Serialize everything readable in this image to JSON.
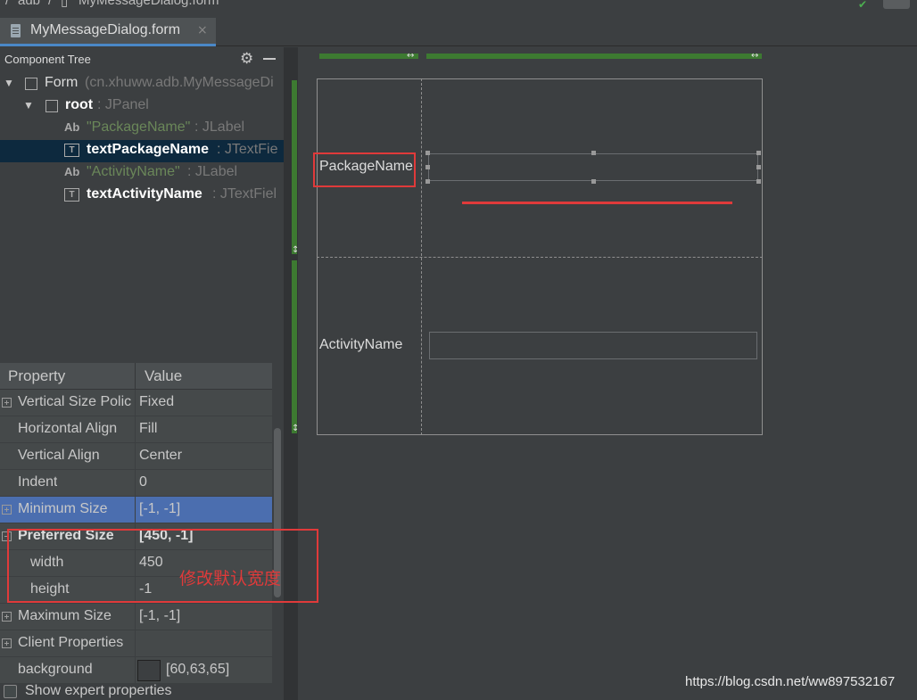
{
  "breadcrumb": {
    "project": "adb",
    "file": "MyMessageDialog.form"
  },
  "tab": {
    "label": "MyMessageDialog.form",
    "close": "×"
  },
  "component_tree": {
    "title": "Component Tree",
    "rows": [
      {
        "name": "Form",
        "detail": "(cn.xhuww.adb.MyMessageDi"
      },
      {
        "name": "root",
        "detail": " : JPanel"
      },
      {
        "name": "\"PackageName\"",
        "detail": " : JLabel",
        "icon": "Ab"
      },
      {
        "name": "textPackageName",
        "detail": " : JTextFie",
        "icon": "T"
      },
      {
        "name": "\"ActivityName\"",
        "detail": " : JLabel",
        "icon": "Ab"
      },
      {
        "name": "textActivityName",
        "detail": " : JTextFiel",
        "icon": "T"
      }
    ]
  },
  "properties": {
    "header": {
      "property": "Property",
      "value": "Value"
    },
    "rows": [
      {
        "name": "Vertical Size Polic",
        "value": "Fixed"
      },
      {
        "name": "Horizontal Align",
        "value": "Fill"
      },
      {
        "name": "Vertical Align",
        "value": "Center"
      },
      {
        "name": "Indent",
        "value": "0"
      },
      {
        "name": "Minimum Size",
        "value": "[-1, -1]"
      },
      {
        "name": "Preferred Size",
        "value": "[450, -1]"
      },
      {
        "name": "width",
        "value": "450"
      },
      {
        "name": "height",
        "value": "-1"
      },
      {
        "name": "Maximum Size",
        "value": "[-1, -1]"
      },
      {
        "name": "Client Properties",
        "value": ""
      },
      {
        "name": "background",
        "value": "[60,63,65]"
      }
    ],
    "show_expert": "Show expert properties"
  },
  "form_preview": {
    "package_label": "PackageName",
    "activity_label": "ActivityName"
  },
  "annotation": "修改默认宽度",
  "watermark": "https://blog.csdn.net/ww897532167",
  "colors": {
    "selection": "#4b6eaf",
    "tree_selection": "#0d293e",
    "annotation_red": "#e03a3a",
    "label_green": "#6a8759",
    "gutter_green": "#3d7a31"
  }
}
